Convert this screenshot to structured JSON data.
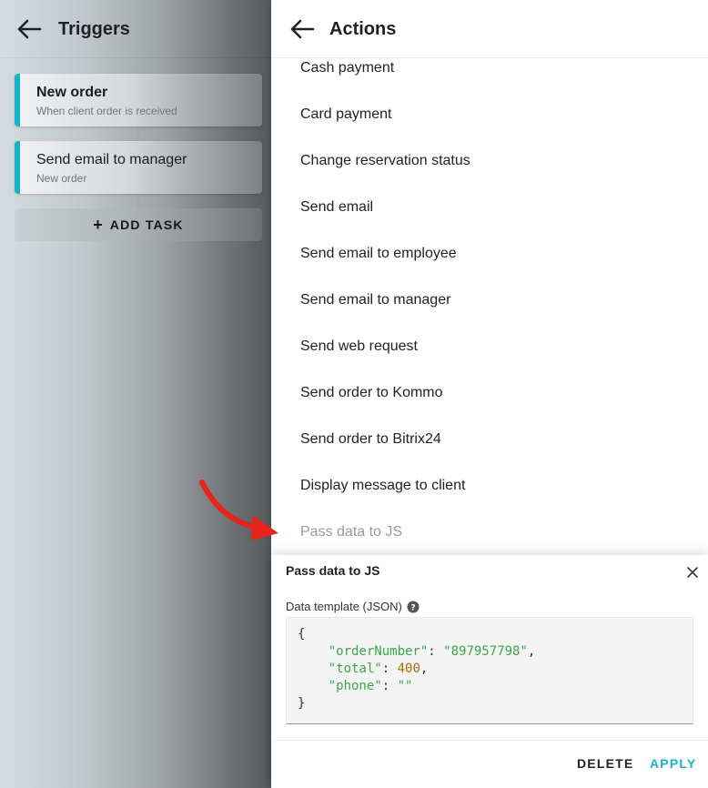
{
  "triggers_panel": {
    "title": "Triggers",
    "cards": [
      {
        "title": "New order",
        "subtitle": "When client order is received"
      },
      {
        "title": "Send email to manager",
        "subtitle": "New order"
      }
    ],
    "add_task_label": "ADD TASK",
    "accent_color": "#17b3c9"
  },
  "actions_panel": {
    "title": "Actions",
    "items": [
      "Cash payment",
      "Card payment",
      "Change reservation status",
      "Send email",
      "Send email to employee",
      "Send email to manager",
      "Send web request",
      "Send order to Kommo",
      "Send order to Bitrix24",
      "Display message to client",
      "Pass data to JS"
    ]
  },
  "sheet": {
    "title": "Pass data to JS",
    "field_label": "Data template (JSON)",
    "code": {
      "open": "{",
      "lines": [
        {
          "key": "\"orderNumber\"",
          "value": "\"897957798\"",
          "value_type": "str",
          "trail": ","
        },
        {
          "key": "\"total\"",
          "value": "400",
          "value_type": "num",
          "trail": ","
        },
        {
          "key": "\"phone\"",
          "value": "\"\"",
          "value_type": "str",
          "trail": ""
        }
      ],
      "close": "}"
    },
    "delete_label": "DELETE",
    "apply_label": "APPLY"
  },
  "colors": {
    "accent": "#17b3c9",
    "string": "#3aa64a",
    "number": "#a66f00",
    "annotation_arrow": "#e8231b"
  }
}
